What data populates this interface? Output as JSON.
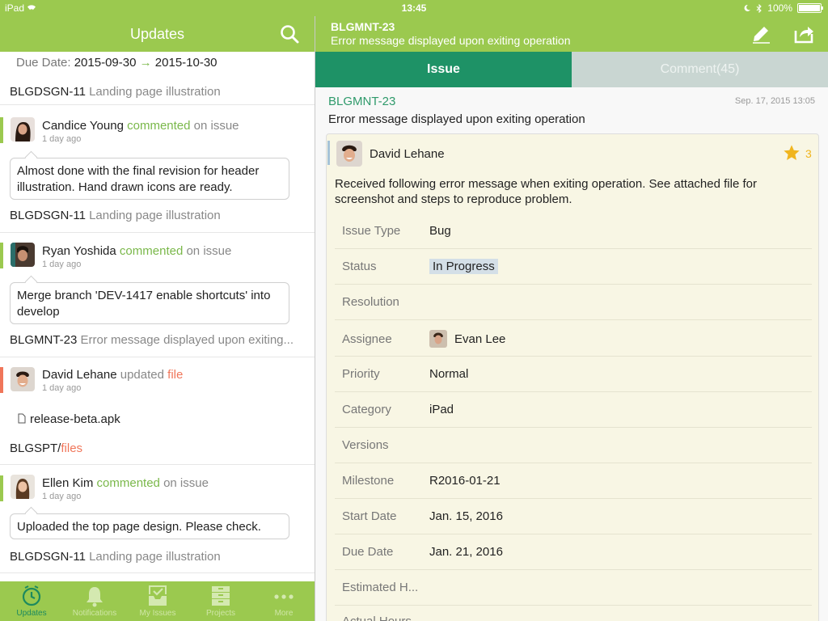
{
  "status_bar": {
    "device": "iPad",
    "time": "13:45",
    "battery": "100%"
  },
  "left_header": {
    "title": "Updates"
  },
  "right_header": {
    "issue_key": "BLGMNT-23",
    "issue_subtitle": "Error message displayed upon exiting operation"
  },
  "feed": {
    "top": {
      "due_label": "Due Date:",
      "due_from": "2015-09-30",
      "arrow": "→",
      "due_to": "2015-10-30",
      "ref_key": "BLGDSGN-11",
      "ref_title": "Landing page illustration"
    },
    "items": [
      {
        "accent": "#9bc94f",
        "actor": "Candice Young",
        "verb": "commented",
        "tail": "on issue",
        "ago": "1 day ago",
        "comment": "Almost done with the final revision for header illustration. Hand drawn icons are ready.",
        "ref_key": "BLGDSGN-11",
        "ref_title": "Landing page illustration"
      },
      {
        "accent": "#9bc94f",
        "actor": "Ryan Yoshida",
        "verb": "commented",
        "tail": "on issue",
        "ago": "1 day ago",
        "comment": "Merge branch 'DEV-1417 enable shortcuts' into develop",
        "ref_key": "BLGMNT-23",
        "ref_title": "Error message displayed upon exiting..."
      },
      {
        "accent": "#f0765a",
        "actor": "David Lehane",
        "verb_plain": "updated",
        "verb_orange": "file",
        "ago": "1 day ago",
        "file_name": "release-beta.apk",
        "ref_key": "BLGSPT/",
        "ref_orange": "files"
      },
      {
        "accent": "#9bc94f",
        "actor": "Ellen Kim",
        "verb": "commented",
        "tail": "on issue",
        "ago": "1 day ago",
        "comment": "Uploaded the top page design. Please check.",
        "ref_key": "BLGDSGN-11",
        "ref_title": "Landing page illustration"
      }
    ]
  },
  "tabbar": {
    "tabs": [
      {
        "label": "Updates",
        "icon": "clock-icon",
        "active": true
      },
      {
        "label": "Notifications",
        "icon": "bell-icon",
        "active": false
      },
      {
        "label": "My Issues",
        "icon": "inbox-check-icon",
        "active": false
      },
      {
        "label": "Projects",
        "icon": "drawer-icon",
        "active": false
      },
      {
        "label": "More",
        "icon": "more-dots-icon",
        "active": false
      }
    ]
  },
  "segments": {
    "issue": "Issue",
    "comment": "Comment(45)"
  },
  "issue": {
    "key": "BLGMNT-23",
    "date": "Sep. 17, 2015 13:05",
    "title": "Error message displayed upon exiting operation",
    "reporter": "David Lehane",
    "stars": "3",
    "description": "Received following error message when exiting operation. See attached file for screenshot and steps to reproduce problem.",
    "properties": [
      {
        "label": "Issue Type",
        "value": "Bug"
      },
      {
        "label": "Status",
        "value": "In Progress"
      },
      {
        "label": "Resolution",
        "value": ""
      },
      {
        "label": "Assignee",
        "value": "Evan Lee"
      },
      {
        "label": "Priority",
        "value": "Normal"
      },
      {
        "label": "Category",
        "value": "iPad"
      },
      {
        "label": "Versions",
        "value": ""
      },
      {
        "label": "Milestone",
        "value": "R2016-01-21"
      },
      {
        "label": "Start Date",
        "value": "Jan. 15, 2016"
      },
      {
        "label": "Due Date",
        "value": "Jan. 21, 2016"
      },
      {
        "label": "Estimated H...",
        "value": ""
      },
      {
        "label": "Actual Hours",
        "value": ""
      }
    ]
  },
  "colors": {
    "brand_green": "#9bc94f",
    "dark_green": "#1e9266",
    "accent_orange": "#f0765a",
    "star_yellow": "#f0b51e"
  }
}
